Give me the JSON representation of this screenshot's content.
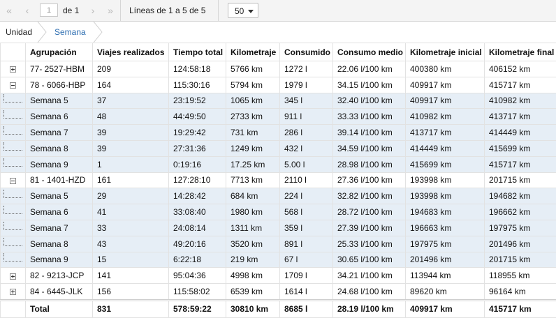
{
  "pager": {
    "first_icon": "«",
    "prev_icon": "‹",
    "page_value": "1",
    "of_label": "de 1",
    "next_icon": "›",
    "last_icon": "»",
    "lines_label": "Líneas de 1 a 5 de 5",
    "page_size": "50"
  },
  "breadcrumb": {
    "items": [
      "Unidad",
      "Semana"
    ]
  },
  "colors": {
    "subrow_bg": "#e6eef6",
    "crumb_active": "#2b6cb0"
  },
  "table": {
    "headers": [
      "Agrupación",
      "Viajes realizados",
      "Tiempo total",
      "Kilometraje",
      "Consumido",
      "Consumo medio",
      "Kilometraje inicial",
      "Kilometraje final"
    ],
    "rows": [
      {
        "kind": "group",
        "toggle": "plus",
        "cells": [
          "77- 2527-HBM",
          "209",
          "124:58:18",
          "5766 km",
          "1272 l",
          "22.06 l/100 km",
          "400380 km",
          "406152 km"
        ]
      },
      {
        "kind": "group",
        "toggle": "minus",
        "cells": [
          "78 - 6066-HBP",
          "164",
          "115:30:16",
          "5794 km",
          "1979 l",
          "34.15 l/100 km",
          "409917 km",
          "415717 km"
        ]
      },
      {
        "kind": "sub",
        "cells": [
          "Semana 5",
          "37",
          "23:19:52",
          "1065 km",
          "345 l",
          "32.40 l/100 km",
          "409917 km",
          "410982 km"
        ]
      },
      {
        "kind": "sub",
        "cells": [
          "Semana 6",
          "48",
          "44:49:50",
          "2733 km",
          "911 l",
          "33.33 l/100 km",
          "410982 km",
          "413717 km"
        ]
      },
      {
        "kind": "sub",
        "cells": [
          "Semana 7",
          "39",
          "19:29:42",
          "731 km",
          "286 l",
          "39.14 l/100 km",
          "413717 km",
          "414449 km"
        ]
      },
      {
        "kind": "sub",
        "cells": [
          "Semana 8",
          "39",
          "27:31:36",
          "1249 km",
          "432 l",
          "34.59 l/100 km",
          "414449 km",
          "415699 km"
        ]
      },
      {
        "kind": "sub",
        "cells": [
          "Semana 9",
          "1",
          "0:19:16",
          "17.25 km",
          "5.00 l",
          "28.98 l/100 km",
          "415699 km",
          "415717 km"
        ]
      },
      {
        "kind": "group",
        "toggle": "minus",
        "cells": [
          "81 - 1401-HZD",
          "161",
          "127:28:10",
          "7713 km",
          "2110 l",
          "27.36 l/100 km",
          "193998 km",
          "201715 km"
        ]
      },
      {
        "kind": "sub",
        "cells": [
          "Semana 5",
          "29",
          "14:28:42",
          "684 km",
          "224 l",
          "32.82 l/100 km",
          "193998 km",
          "194682 km"
        ]
      },
      {
        "kind": "sub",
        "cells": [
          "Semana 6",
          "41",
          "33:08:40",
          "1980 km",
          "568 l",
          "28.72 l/100 km",
          "194683 km",
          "196662 km"
        ]
      },
      {
        "kind": "sub",
        "cells": [
          "Semana 7",
          "33",
          "24:08:14",
          "1311 km",
          "359 l",
          "27.39 l/100 km",
          "196663 km",
          "197975 km"
        ]
      },
      {
        "kind": "sub",
        "cells": [
          "Semana 8",
          "43",
          "49:20:16",
          "3520 km",
          "891 l",
          "25.33 l/100 km",
          "197975 km",
          "201496 km"
        ]
      },
      {
        "kind": "sub",
        "cells": [
          "Semana 9",
          "15",
          "6:22:18",
          "219 km",
          "67 l",
          "30.65 l/100 km",
          "201496 km",
          "201715 km"
        ]
      },
      {
        "kind": "group",
        "toggle": "plus",
        "cells": [
          "82 - 9213-JCP",
          "141",
          "95:04:36",
          "4998 km",
          "1709 l",
          "34.21 l/100 km",
          "113944 km",
          "118955 km"
        ]
      },
      {
        "kind": "group",
        "toggle": "plus",
        "cells": [
          "84 - 6445-JLK",
          "156",
          "115:58:02",
          "6539 km",
          "1614 l",
          "24.68 l/100 km",
          "89620 km",
          "96164 km"
        ]
      }
    ],
    "total": [
      "Total",
      "831",
      "578:59:22",
      "30810 km",
      "8685 l",
      "28.19 l/100 km",
      "409917 km",
      "415717 km"
    ]
  }
}
